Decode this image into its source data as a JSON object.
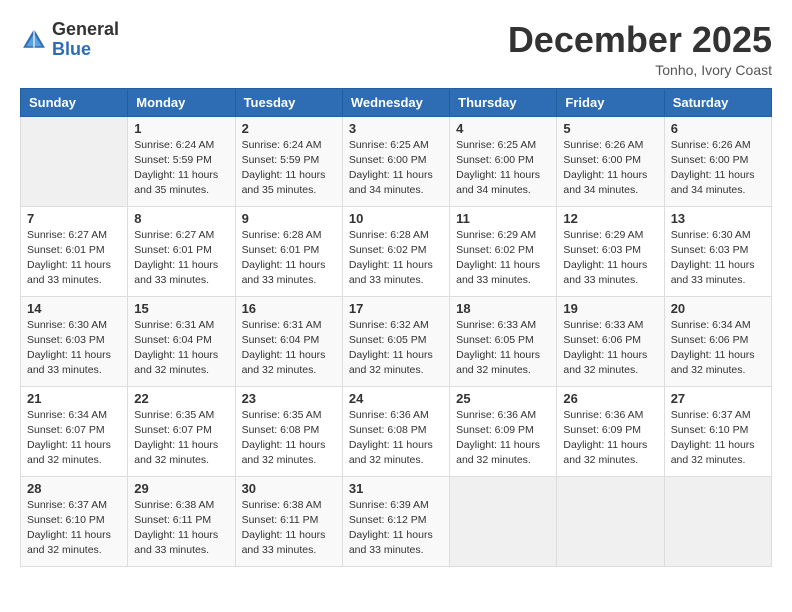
{
  "header": {
    "logo_general": "General",
    "logo_blue": "Blue",
    "month_title": "December 2025",
    "location": "Tonho, Ivory Coast"
  },
  "days_of_week": [
    "Sunday",
    "Monday",
    "Tuesday",
    "Wednesday",
    "Thursday",
    "Friday",
    "Saturday"
  ],
  "weeks": [
    [
      {
        "day": "",
        "info": ""
      },
      {
        "day": "1",
        "info": "Sunrise: 6:24 AM\nSunset: 5:59 PM\nDaylight: 11 hours and 35 minutes."
      },
      {
        "day": "2",
        "info": "Sunrise: 6:24 AM\nSunset: 5:59 PM\nDaylight: 11 hours and 35 minutes."
      },
      {
        "day": "3",
        "info": "Sunrise: 6:25 AM\nSunset: 6:00 PM\nDaylight: 11 hours and 34 minutes."
      },
      {
        "day": "4",
        "info": "Sunrise: 6:25 AM\nSunset: 6:00 PM\nDaylight: 11 hours and 34 minutes."
      },
      {
        "day": "5",
        "info": "Sunrise: 6:26 AM\nSunset: 6:00 PM\nDaylight: 11 hours and 34 minutes."
      },
      {
        "day": "6",
        "info": "Sunrise: 6:26 AM\nSunset: 6:00 PM\nDaylight: 11 hours and 34 minutes."
      }
    ],
    [
      {
        "day": "7",
        "info": "Sunrise: 6:27 AM\nSunset: 6:01 PM\nDaylight: 11 hours and 33 minutes."
      },
      {
        "day": "8",
        "info": "Sunrise: 6:27 AM\nSunset: 6:01 PM\nDaylight: 11 hours and 33 minutes."
      },
      {
        "day": "9",
        "info": "Sunrise: 6:28 AM\nSunset: 6:01 PM\nDaylight: 11 hours and 33 minutes."
      },
      {
        "day": "10",
        "info": "Sunrise: 6:28 AM\nSunset: 6:02 PM\nDaylight: 11 hours and 33 minutes."
      },
      {
        "day": "11",
        "info": "Sunrise: 6:29 AM\nSunset: 6:02 PM\nDaylight: 11 hours and 33 minutes."
      },
      {
        "day": "12",
        "info": "Sunrise: 6:29 AM\nSunset: 6:03 PM\nDaylight: 11 hours and 33 minutes."
      },
      {
        "day": "13",
        "info": "Sunrise: 6:30 AM\nSunset: 6:03 PM\nDaylight: 11 hours and 33 minutes."
      }
    ],
    [
      {
        "day": "14",
        "info": "Sunrise: 6:30 AM\nSunset: 6:03 PM\nDaylight: 11 hours and 33 minutes."
      },
      {
        "day": "15",
        "info": "Sunrise: 6:31 AM\nSunset: 6:04 PM\nDaylight: 11 hours and 32 minutes."
      },
      {
        "day": "16",
        "info": "Sunrise: 6:31 AM\nSunset: 6:04 PM\nDaylight: 11 hours and 32 minutes."
      },
      {
        "day": "17",
        "info": "Sunrise: 6:32 AM\nSunset: 6:05 PM\nDaylight: 11 hours and 32 minutes."
      },
      {
        "day": "18",
        "info": "Sunrise: 6:33 AM\nSunset: 6:05 PM\nDaylight: 11 hours and 32 minutes."
      },
      {
        "day": "19",
        "info": "Sunrise: 6:33 AM\nSunset: 6:06 PM\nDaylight: 11 hours and 32 minutes."
      },
      {
        "day": "20",
        "info": "Sunrise: 6:34 AM\nSunset: 6:06 PM\nDaylight: 11 hours and 32 minutes."
      }
    ],
    [
      {
        "day": "21",
        "info": "Sunrise: 6:34 AM\nSunset: 6:07 PM\nDaylight: 11 hours and 32 minutes."
      },
      {
        "day": "22",
        "info": "Sunrise: 6:35 AM\nSunset: 6:07 PM\nDaylight: 11 hours and 32 minutes."
      },
      {
        "day": "23",
        "info": "Sunrise: 6:35 AM\nSunset: 6:08 PM\nDaylight: 11 hours and 32 minutes."
      },
      {
        "day": "24",
        "info": "Sunrise: 6:36 AM\nSunset: 6:08 PM\nDaylight: 11 hours and 32 minutes."
      },
      {
        "day": "25",
        "info": "Sunrise: 6:36 AM\nSunset: 6:09 PM\nDaylight: 11 hours and 32 minutes."
      },
      {
        "day": "26",
        "info": "Sunrise: 6:36 AM\nSunset: 6:09 PM\nDaylight: 11 hours and 32 minutes."
      },
      {
        "day": "27",
        "info": "Sunrise: 6:37 AM\nSunset: 6:10 PM\nDaylight: 11 hours and 32 minutes."
      }
    ],
    [
      {
        "day": "28",
        "info": "Sunrise: 6:37 AM\nSunset: 6:10 PM\nDaylight: 11 hours and 32 minutes."
      },
      {
        "day": "29",
        "info": "Sunrise: 6:38 AM\nSunset: 6:11 PM\nDaylight: 11 hours and 33 minutes."
      },
      {
        "day": "30",
        "info": "Sunrise: 6:38 AM\nSunset: 6:11 PM\nDaylight: 11 hours and 33 minutes."
      },
      {
        "day": "31",
        "info": "Sunrise: 6:39 AM\nSunset: 6:12 PM\nDaylight: 11 hours and 33 minutes."
      },
      {
        "day": "",
        "info": ""
      },
      {
        "day": "",
        "info": ""
      },
      {
        "day": "",
        "info": ""
      }
    ]
  ]
}
